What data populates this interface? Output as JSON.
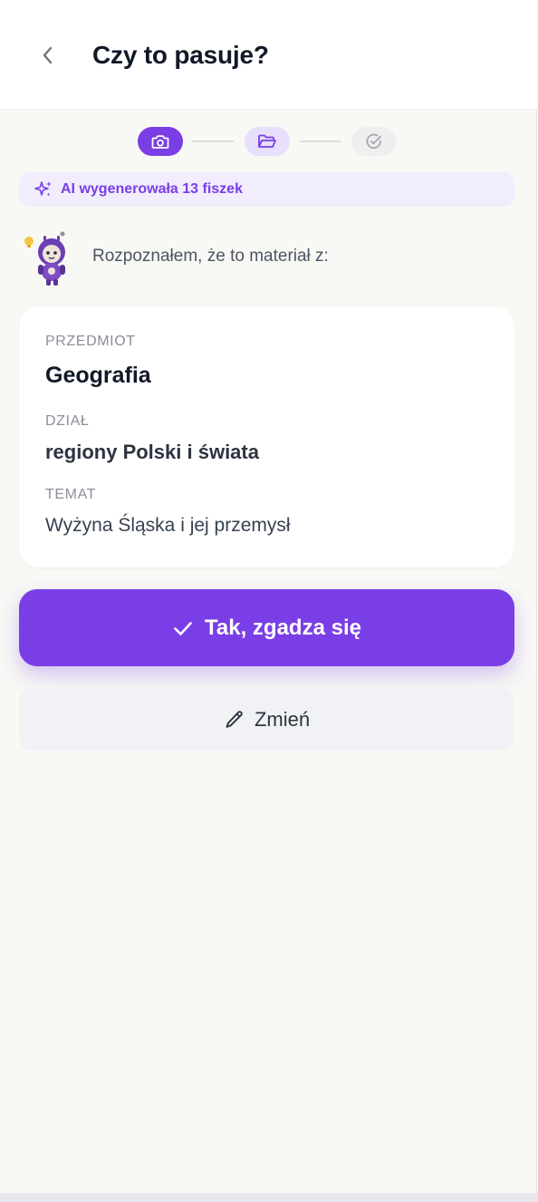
{
  "header": {
    "title": "Czy to pasuje?",
    "back_icon": "chevron-left-icon"
  },
  "stepper": {
    "steps": [
      {
        "icon": "camera-icon",
        "state": "active"
      },
      {
        "icon": "folder-open-icon",
        "state": "current"
      },
      {
        "icon": "check-circle-icon",
        "state": "upcoming"
      }
    ],
    "colors": {
      "active": "#7a3ee6",
      "current": "#e7dffb",
      "upcoming": "#efefef"
    }
  },
  "ai_badge": {
    "icon": "sparkles-icon",
    "text": "AI wygenerowała 13 fiszek"
  },
  "mascot": {
    "icon": "robot-mascot-icon",
    "message": "Rozpoznałem, że to materiał z:"
  },
  "card": {
    "subject_label": "PRZEDMIOT",
    "subject_value": "Geografia",
    "section_label": "DZIAŁ",
    "section_value": "regiony Polski i świata",
    "topic_label": "TEMAT",
    "topic_value": "Wyżyna Śląska i jej przemysł"
  },
  "actions": {
    "confirm_label": "Tak, zgadza się",
    "confirm_icon": "check-icon",
    "change_label": "Zmień",
    "change_icon": "pencil-icon"
  },
  "colors": {
    "accent": "#7a3ee6",
    "accent_light": "#f1edfd",
    "background": "#f8f8f5"
  }
}
